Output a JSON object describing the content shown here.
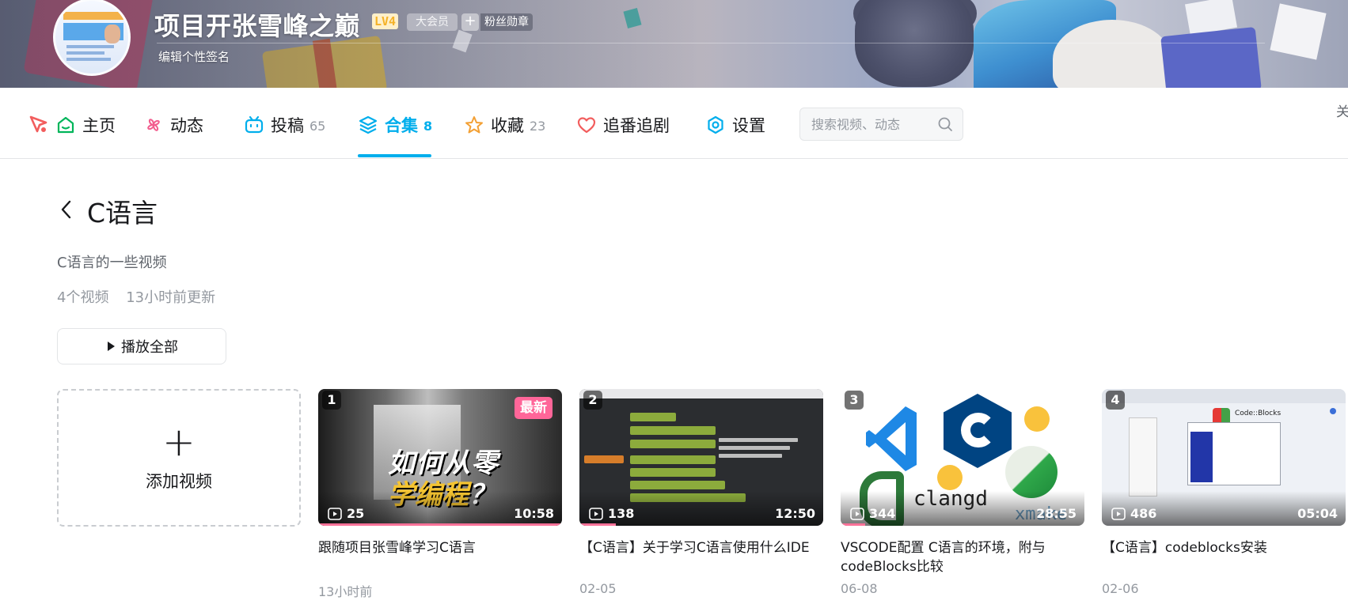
{
  "header": {
    "username": "项目开张雪峰之巅",
    "level": "LV4",
    "vip_label": "大会员",
    "fan_badge_plus": "+",
    "fan_badge_label": "粉丝勋章",
    "signature": "编辑个性签名"
  },
  "nav": {
    "items": [
      {
        "label": "主页",
        "icon": "home-icon",
        "count": ""
      },
      {
        "label": "动态",
        "icon": "pinwheel-icon",
        "count": ""
      },
      {
        "label": "投稿",
        "icon": "tv-icon",
        "count": "65"
      },
      {
        "label": "合集",
        "icon": "layers-icon",
        "count": "8",
        "active": true
      },
      {
        "label": "收藏",
        "icon": "star-icon",
        "count": "23"
      },
      {
        "label": "追番追剧",
        "icon": "heart-icon",
        "count": ""
      },
      {
        "label": "设置",
        "icon": "settings-icon",
        "count": ""
      }
    ],
    "search_placeholder": "搜索视频、动态",
    "follow_cut": "关"
  },
  "collection": {
    "title": "C语言",
    "description": "C语言的一些视频",
    "video_count": "4个视频",
    "updated": "13小时前更新",
    "play_all_label": "播放全部",
    "add_video_label": "添加视频"
  },
  "videos": [
    {
      "index": "1",
      "new_tag": "最新",
      "views": "25",
      "duration": "10:58",
      "title": "跟随项目张雪峰学习C语言",
      "date": "13小时前",
      "progress": 1.0,
      "thumb_text1": "如何从零",
      "thumb_text2": "学编程",
      "thumb_text3": "？"
    },
    {
      "index": "2",
      "views": "138",
      "duration": "12:50",
      "title": "【C语言】关于学习C语言使用什么IDE",
      "date": "02-05",
      "progress": 0.15
    },
    {
      "index": "3",
      "views": "344",
      "duration": "28:55",
      "title": "VSCODE配置 C语言的环境，附与codeBlocks比较",
      "date": "06-08",
      "progress": 0.1,
      "thumb_text1": "clangd",
      "thumb_text2": "xmake"
    },
    {
      "index": "4",
      "views": "486",
      "duration": "05:04",
      "title": "【C语言】codeblocks安装",
      "date": "02-06",
      "progress": 0.0,
      "thumb_text1": "Code::Blocks"
    }
  ],
  "colors": {
    "accent": "#00aeec",
    "new_tag": "#ff6699",
    "level": "#f5b227"
  }
}
